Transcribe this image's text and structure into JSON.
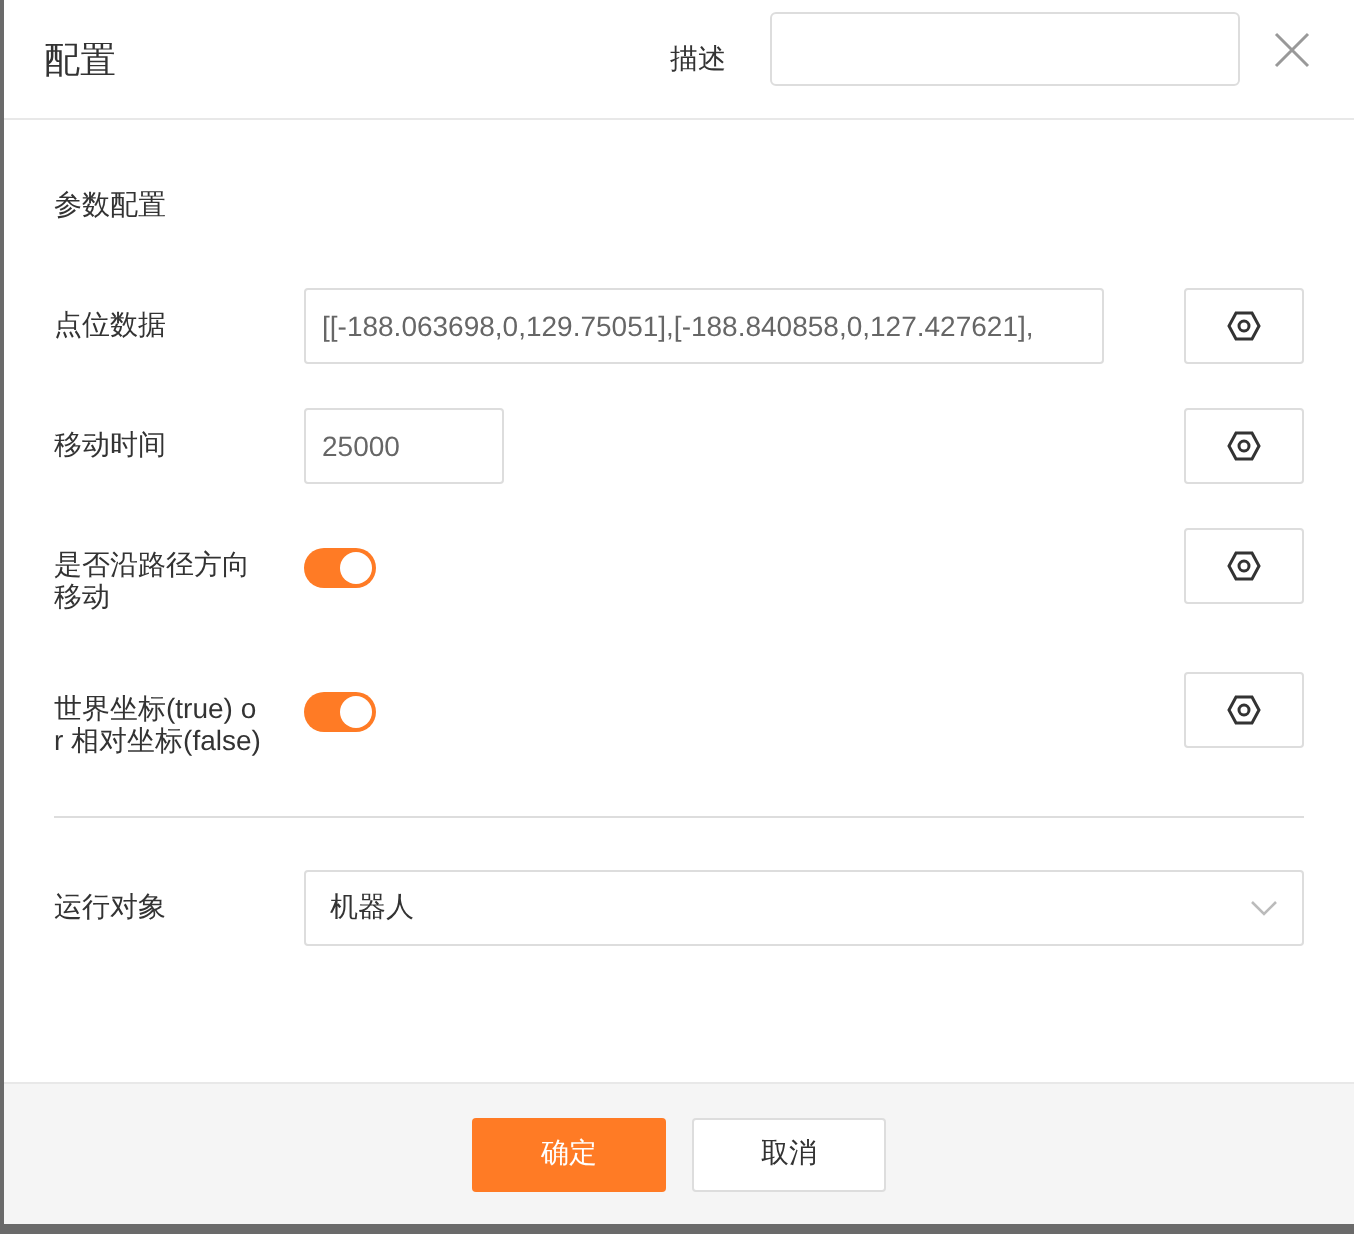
{
  "dialog": {
    "title": "配置",
    "description_label": "描述",
    "section_title": "参数配置",
    "fields": [
      {
        "kind": "text",
        "label": "点位数据",
        "value": "[[-188.063698,0,129.75051],[-188.840858,0,127.427621],"
      },
      {
        "kind": "number",
        "label": "移动时间",
        "value": "25000"
      },
      {
        "kind": "switch",
        "label": "是否沿路径方向移动",
        "on": true
      },
      {
        "kind": "switch",
        "label": "世界坐标(true) or 相对坐标(false)",
        "on": true
      }
    ],
    "target": {
      "label": "运行对象",
      "value": "机器人"
    },
    "buttons": [
      {
        "kind": "primary",
        "label": "确定"
      },
      {
        "kind": "default",
        "label": "取消"
      }
    ]
  }
}
